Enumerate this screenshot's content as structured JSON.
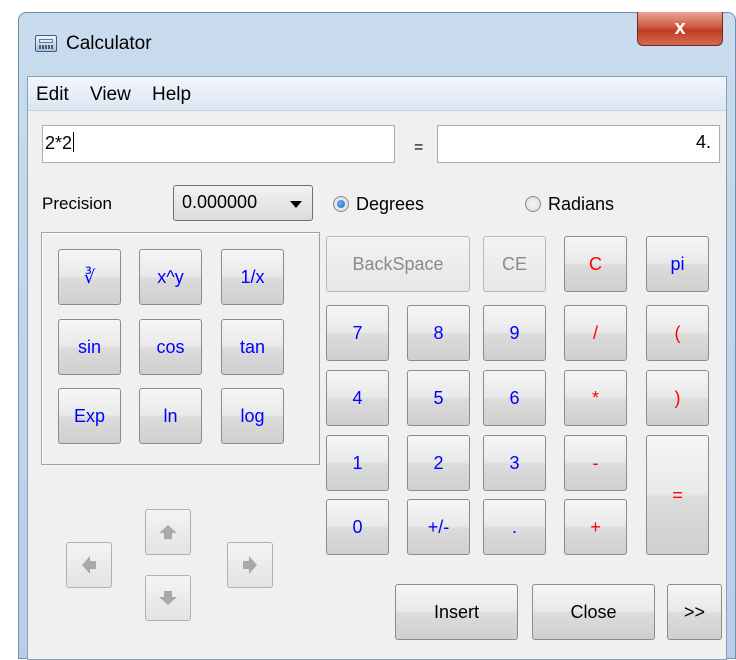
{
  "window": {
    "title": "Calculator",
    "close_glyph": "x"
  },
  "menu": [
    "Edit",
    "View",
    "Help"
  ],
  "expression": {
    "value": "2*2"
  },
  "equals_sign": "=",
  "result": {
    "value": "4."
  },
  "precision": {
    "label": "Precision",
    "selected": "0.000000"
  },
  "angle_mode": {
    "degrees": "Degrees",
    "radians": "Radians",
    "selected": "Degrees"
  },
  "function_keys": [
    {
      "label": "∛",
      "name": "cube-root-button"
    },
    {
      "label": "x^y",
      "name": "power-button"
    },
    {
      "label": "1/x",
      "name": "reciprocal-button"
    },
    {
      "label": "sin",
      "name": "sin-button"
    },
    {
      "label": "cos",
      "name": "cos-button"
    },
    {
      "label": "tan",
      "name": "tan-button"
    },
    {
      "label": "Exp",
      "name": "exp-button"
    },
    {
      "label": "ln",
      "name": "ln-button"
    },
    {
      "label": "log",
      "name": "log-button"
    }
  ],
  "keypad": {
    "backspace": "BackSpace",
    "ce": "CE",
    "c": "C",
    "pi": "pi",
    "d7": "7",
    "d8": "8",
    "d9": "9",
    "div": "/",
    "lparen": "(",
    "d4": "4",
    "d5": "5",
    "d6": "6",
    "mul": "*",
    "rparen": ")",
    "d1": "1",
    "d2": "2",
    "d3": "3",
    "sub": "-",
    "eq": "=",
    "d0": "0",
    "neg": "+/-",
    "dot": ".",
    "add": "+"
  },
  "actions": {
    "insert": "Insert",
    "close": "Close",
    "more": ">>"
  },
  "icons": [
    "calculator-icon",
    "close-icon",
    "arrow-up-icon",
    "arrow-down-icon",
    "arrow-left-icon",
    "arrow-right-icon",
    "chevron-down-icon"
  ],
  "colors": {
    "operator": "#ff0000",
    "digit": "#0000ff",
    "disabled": "#8a8a8a"
  }
}
